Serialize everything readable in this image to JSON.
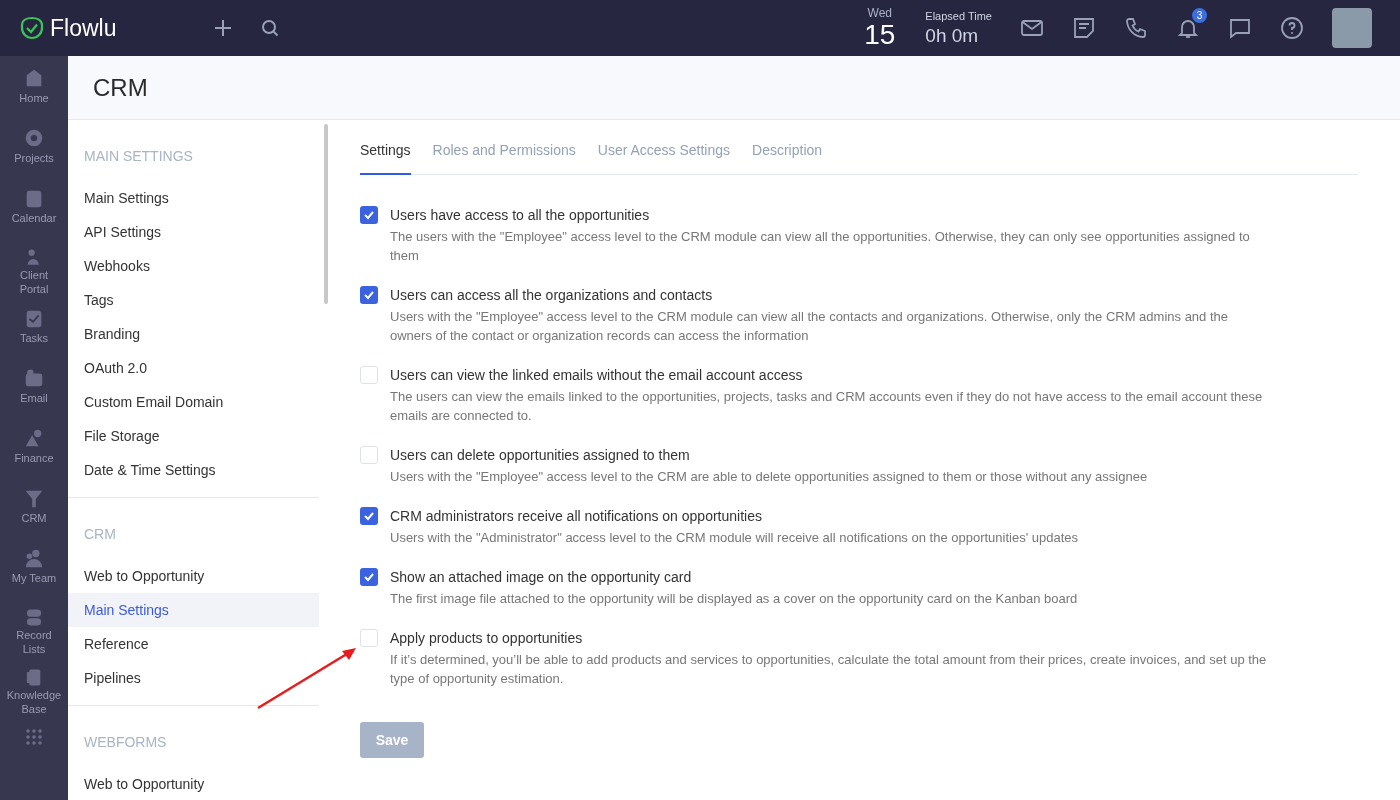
{
  "topbar": {
    "logo": "Flowlu",
    "day_name": "Wed",
    "day_number": "15",
    "elapsed_label": "Elapsed Time",
    "elapsed_value": "0h 0m",
    "notification_count": "3"
  },
  "nav": [
    {
      "label": "Home"
    },
    {
      "label": "Projects"
    },
    {
      "label": "Calendar"
    },
    {
      "label": "Client Portal"
    },
    {
      "label": "Tasks"
    },
    {
      "label": "Email"
    },
    {
      "label": "Finance"
    },
    {
      "label": "CRM"
    },
    {
      "label": "My Team"
    },
    {
      "label": "Record Lists"
    },
    {
      "label": "Knowledge Base"
    }
  ],
  "page_title": "CRM",
  "settings_menu": [
    {
      "heading": "MAIN SETTINGS",
      "items": [
        {
          "label": "Main Settings",
          "selected": false
        },
        {
          "label": "API Settings",
          "selected": false
        },
        {
          "label": "Webhooks",
          "selected": false
        },
        {
          "label": "Tags",
          "selected": false
        },
        {
          "label": "Branding",
          "selected": false
        },
        {
          "label": "OAuth 2.0",
          "selected": false
        },
        {
          "label": "Custom Email Domain",
          "selected": false
        },
        {
          "label": "File Storage",
          "selected": false
        },
        {
          "label": "Date & Time Settings",
          "selected": false
        }
      ]
    },
    {
      "heading": "CRM",
      "items": [
        {
          "label": "Web to Opportunity",
          "selected": false
        },
        {
          "label": "Main Settings",
          "selected": true
        },
        {
          "label": "Reference",
          "selected": false
        },
        {
          "label": "Pipelines",
          "selected": false
        }
      ]
    },
    {
      "heading": "WEBFORMS",
      "items": [
        {
          "label": "Web to Opportunity",
          "selected": false
        }
      ]
    }
  ],
  "tabs": [
    {
      "label": "Settings",
      "selected": true
    },
    {
      "label": "Roles and Permissions",
      "selected": false
    },
    {
      "label": "User Access Settings",
      "selected": false
    },
    {
      "label": "Description",
      "selected": false
    }
  ],
  "options": [
    {
      "title": "Users have access to all the opportunities",
      "description": "The users with the \"Employee\" access level to the CRM module can view all the opportunities. Otherwise, they can only see opportunities assigned to them",
      "checked": true
    },
    {
      "title": "Users can access all the organizations and contacts",
      "description": "Users with the \"Employee\" access level to the CRM module can view all the contacts and organizations. Otherwise, only the CRM admins and the owners of the contact or organization records can access the information",
      "checked": true
    },
    {
      "title": "Users can view the linked emails without the email account access",
      "description": "The users can view the emails linked to the opportunities, projects, tasks and CRM accounts even if they do not have access to the email account these emails are connected to.",
      "checked": false
    },
    {
      "title": "Users can delete opportunities assigned to them",
      "description": "Users with the \"Employee\" access level to the CRM are able to delete opportunities assigned to them or those without any assignee",
      "checked": false
    },
    {
      "title": "CRM administrators receive all notifications on opportunities",
      "description": "Users with the \"Administrator\" access level to the CRM module will receive all notifications on the opportunities' updates",
      "checked": true
    },
    {
      "title": "Show an attached image on the opportunity card",
      "description": "The first image file attached to the opportunity will be displayed as a cover on the opportunity card on the Kanban board",
      "checked": true
    },
    {
      "title": "Apply products to opportunities",
      "description": "If it’s determined, you’ll be able to add products and services to opportunities, calculate the total amount from their prices, create invoices, and set up the type of opportunity estimation.",
      "checked": false
    }
  ],
  "save_button": "Save"
}
